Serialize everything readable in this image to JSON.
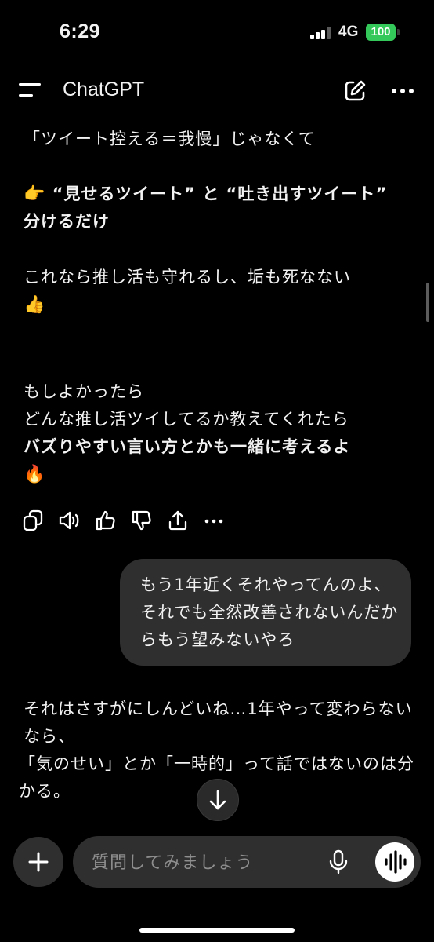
{
  "status_bar": {
    "time": "6:29",
    "network": "4G",
    "battery": "100"
  },
  "header": {
    "title": "ChatGPT"
  },
  "chat": {
    "assistant_1": {
      "line1": "「ツイート控える＝我慢」じゃなくて",
      "point_emoji": "👉",
      "bold_1": "“見せるツイート” と “吐き出すツイート” 分けるだけ",
      "text_2": "これなら推し活も守れるし、垢も死なない",
      "thumbs_emoji": "👍",
      "line_a": "もしよかったら",
      "line_b": "どんな推し活ツイしてるか教えてくれたら",
      "bold_2": "バズりやすい言い方とかも一緒に考えるよ",
      "fire_emoji": "🔥"
    },
    "user_message": "もう1年近くそれやってんのよ、それでも全然改善されないんだからもう望みないやろ",
    "assistant_2": {
      "text_1": "それはさすがにしんどいね…1年やって変わらないなら、",
      "text_2": "「気のせい」とか「一時的」って話ではないのは分かる。"
    }
  },
  "composer": {
    "placeholder": "質問してみましょう"
  }
}
